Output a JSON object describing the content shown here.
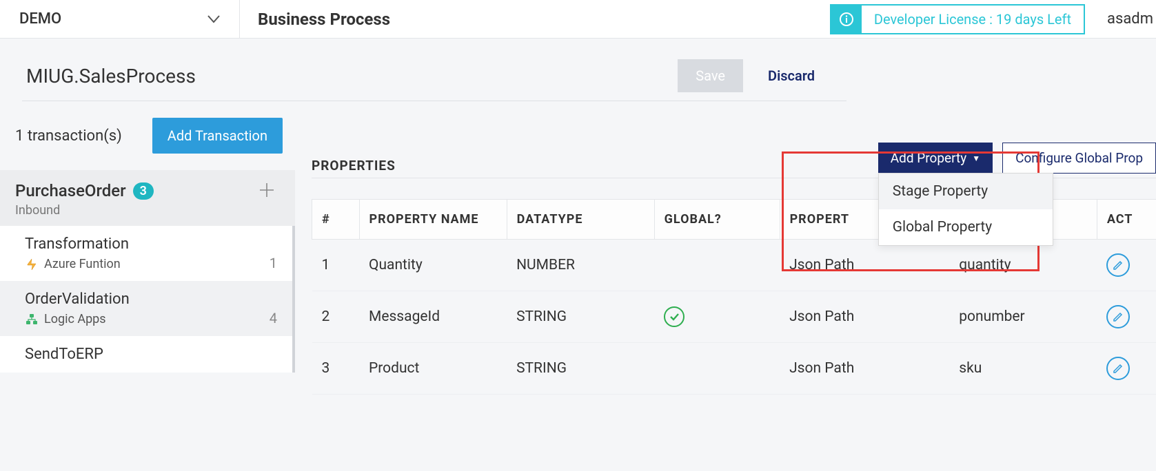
{
  "header": {
    "env": "DEMO",
    "title": "Business Process",
    "license_text": "Developer License : 19 days Left",
    "user": "asadm"
  },
  "page": {
    "title": "MIUG.SalesProcess",
    "save_label": "Save",
    "discard_label": "Discard"
  },
  "sidebar": {
    "tx_count_label": "1 transaction(s)",
    "add_tx_label": "Add Transaction",
    "transaction": {
      "name": "PurchaseOrder",
      "badge": "3",
      "direction": "Inbound"
    },
    "stages": [
      {
        "name": "Transformation",
        "sub": "Azure Funtion",
        "count": "1",
        "icon": "azure-function"
      },
      {
        "name": "OrderValidation",
        "sub": "Logic Apps",
        "count": "4",
        "icon": "logic-apps"
      },
      {
        "name": "SendToERP",
        "sub": "",
        "count": "",
        "icon": ""
      }
    ]
  },
  "properties": {
    "title": "PROPERTIES",
    "add_prop_label": "Add Property",
    "configure_global_label": "Configure Global Prop",
    "dropdown": {
      "stage": "Stage Property",
      "global": "Global Property"
    },
    "columns": {
      "idx": "#",
      "name": "PROPERTY NAME",
      "dtype": "DATATYPE",
      "global": "GLOBAL?",
      "proptype": "PROPERT",
      "value": "",
      "actions": "ACT"
    },
    "rows": [
      {
        "idx": "1",
        "name": "Quantity",
        "dtype": "NUMBER",
        "global": false,
        "proptype": "Json Path",
        "value": "quantity"
      },
      {
        "idx": "2",
        "name": "MessageId",
        "dtype": "STRING",
        "global": true,
        "proptype": "Json Path",
        "value": "ponumber"
      },
      {
        "idx": "3",
        "name": "Product",
        "dtype": "STRING",
        "global": false,
        "proptype": "Json Path",
        "value": "sku"
      }
    ]
  }
}
